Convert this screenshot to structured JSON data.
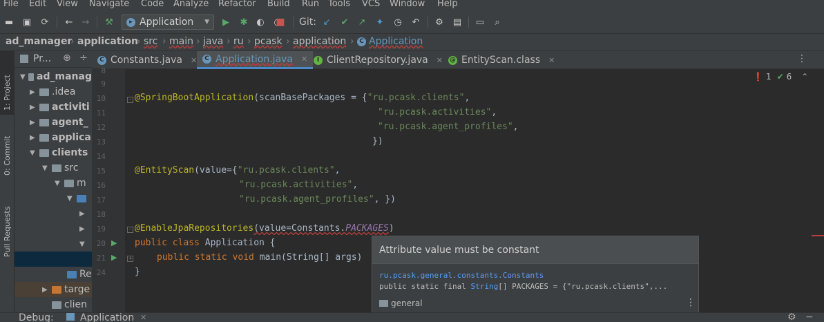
{
  "menu": [
    "File",
    "Edit",
    "View",
    "Navigate",
    "Code",
    "Analyze",
    "Refactor",
    "Build",
    "Run",
    "Tools",
    "VCS",
    "Window",
    "Help"
  ],
  "toolbar": {
    "run_config": "Application",
    "git_label": "Git:",
    "icons": [
      "open-folder-icon",
      "save-icon",
      "sync-icon",
      "back-icon",
      "forward-icon",
      "build-hammer-icon",
      "run-icon",
      "debug-icon",
      "coverage-icon",
      "profile-icon",
      "stop-icon",
      "vcs-update-icon",
      "vcs-commit-icon",
      "vcs-push-icon",
      "vcs-merge-icon",
      "history-icon",
      "rollback-icon",
      "settings-wrench-icon",
      "project-structure-icon",
      "terminal-icon",
      "search-icon"
    ]
  },
  "breadcrumb": [
    "ad_manager",
    "application",
    "src",
    "main",
    "java",
    "ru",
    "pcask",
    "application",
    "Application"
  ],
  "left_strip": {
    "project_tab": "1: Project",
    "commit_tab": "0: Commit",
    "pull_requests_tab": "Pull Requests"
  },
  "project": {
    "header": "Pr...",
    "tree": [
      {
        "label": "ad_manag",
        "bold": true
      },
      {
        "label": ".idea",
        "bold": false
      },
      {
        "label": "activiti",
        "bold": true
      },
      {
        "label": "agent_",
        "bold": true
      },
      {
        "label": "applica",
        "bold": true
      },
      {
        "label": "clients",
        "bold": true
      },
      {
        "label": "src",
        "bold": false
      },
      {
        "label": "m",
        "bold": false
      },
      {
        "label": "",
        "bold": false
      },
      {
        "label": "",
        "bold": false
      },
      {
        "label": "",
        "bold": false
      },
      {
        "label": "",
        "bold": false
      },
      {
        "label": "",
        "bold": false
      },
      {
        "label": "Re",
        "bold": false
      },
      {
        "label": "targe",
        "bold": false
      },
      {
        "label": "clien",
        "bold": false
      }
    ]
  },
  "tabs": [
    {
      "label": "Constants.java",
      "active": false
    },
    {
      "label": "Application.java",
      "active": true
    },
    {
      "label": "ClientRepository.java",
      "active": false
    },
    {
      "label": "EntityScan.class",
      "active": false
    }
  ],
  "inspection": {
    "errors": "1",
    "warnings": "6"
  },
  "line_numbers": [
    "8",
    "9",
    "10",
    "11",
    "12",
    "13",
    "14",
    "15",
    "16",
    "17",
    "18",
    "19",
    "20",
    "21",
    "24"
  ],
  "code": {
    "l10_ann": "@SpringBootApplication",
    "l10_a": "(scanBasePackages = {",
    "l10_s": "\"ru.pcask.clients\"",
    "l10_b": ",",
    "l11_s": "\"ru.pcask.activities\"",
    "l11_b": ",",
    "l12_s": "\"ru.pcask.agent_profiles\"",
    "l12_b": ",",
    "l13": "})",
    "l15_ann": "@EntityScan",
    "l15_a": "(value={",
    "l15_s": "\"ru.pcask.clients\"",
    "l15_b": ",",
    "l16_s": "\"ru.pcask.activities\"",
    "l16_b": ",",
    "l17_s": "\"ru.pcask.agent_profiles\"",
    "l17_b": ", })",
    "l19_ann": "@EnableJpaRepositories",
    "l19_a": "(value=Constants.",
    "l19_c": "PACKAGES",
    "l19_b": ")",
    "l20_kw": "public class",
    "l20_a": " Application {",
    "l21_kw": "public static void",
    "l21_a": " main(String[] args)",
    "l24": "}"
  },
  "popup": {
    "title": "Attribute value must be constant",
    "fqn": "ru.pcask.general.constants.Constants",
    "decl_kw": "public static final ",
    "decl_type": "String",
    "decl_rest": "[] PACKAGES = {\"ru.pcask.clients\",...",
    "package": "general"
  },
  "bottom": {
    "debug_label": "Debug:",
    "config": "Application"
  }
}
